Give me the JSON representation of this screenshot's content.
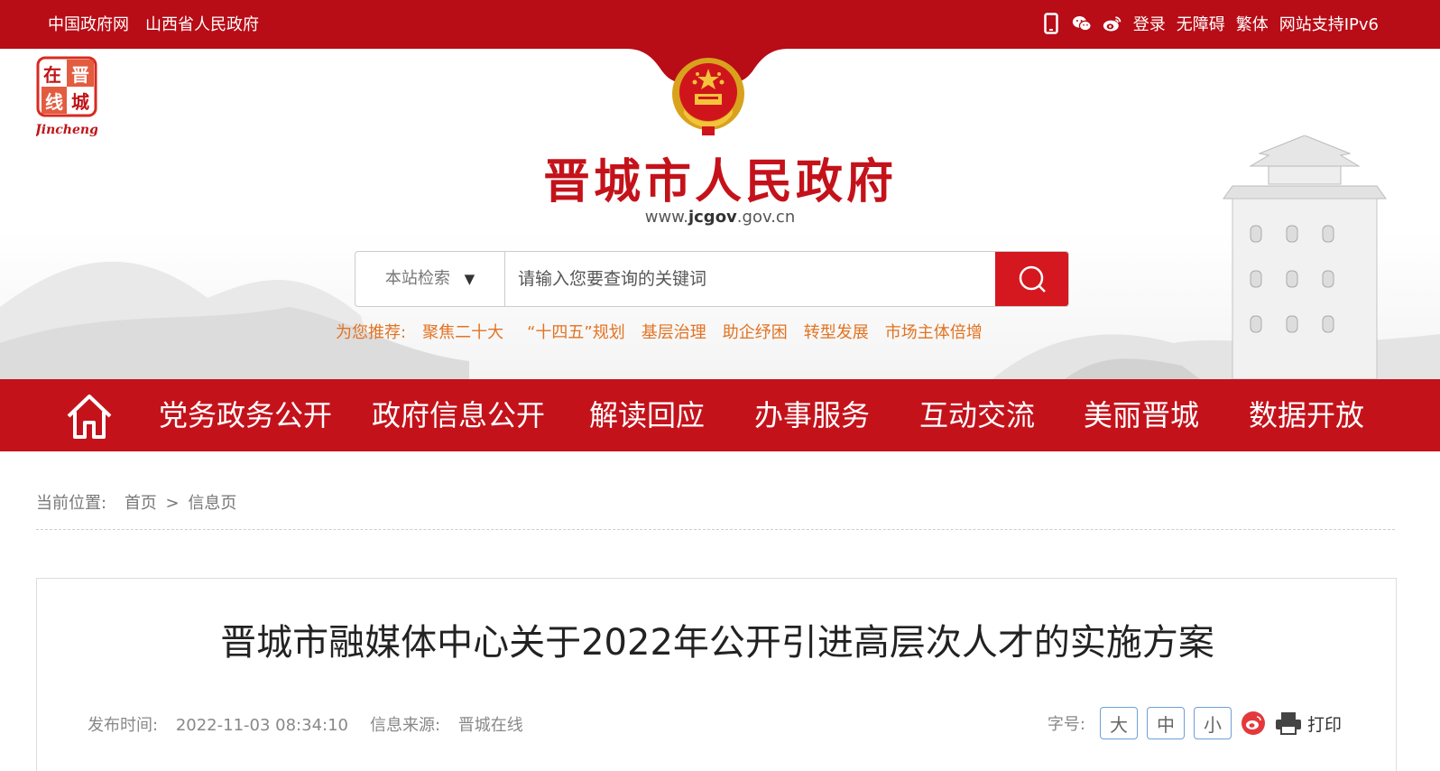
{
  "topbar": {
    "links_left": [
      "中国政府网",
      "山西省人民政府"
    ],
    "links_right": [
      "登录",
      "无障碍",
      "繁体",
      "网站支持IPv6"
    ],
    "icons": [
      "mobile-icon",
      "wechat-icon",
      "weibo-icon"
    ]
  },
  "header": {
    "logo_text": [
      "在",
      "晋",
      "线",
      "城"
    ],
    "logo_caption": "Jincheng",
    "title": "晋城市人民政府",
    "url_prefix": "www.",
    "url_main": "jcgov",
    "url_suffix": ".gov.cn"
  },
  "search": {
    "scope_label": "本站检索",
    "scope_arrow": "▼",
    "placeholder": "请输入您要查询的关键词"
  },
  "recommend": {
    "label": "为您推荐:",
    "items": [
      "聚焦二十大",
      "“十四五”规划",
      "基层治理",
      "助企纾困",
      "转型发展",
      "市场主体倍增"
    ]
  },
  "nav": {
    "items": [
      "党务政务公开",
      "政府信息公开",
      "解读回应",
      "办事服务",
      "互动交流",
      "美丽晋城",
      "数据开放"
    ]
  },
  "breadcrumb": {
    "label": "当前位置:",
    "home": "首页",
    "sep": ">",
    "current": "信息页"
  },
  "article": {
    "title": "晋城市融媒体中心关于2022年公开引进高层次人才的实施方案",
    "publish_label": "发布时间:",
    "publish_time": "2022-11-03 08:34:10",
    "source_label": "信息来源:",
    "source": "晋城在线",
    "font_label": "字号:",
    "font_sizes": [
      "大",
      "中",
      "小"
    ],
    "print_label": "打印"
  },
  "colors": {
    "brand_red": "#b80c16",
    "nav_red": "#c4121b",
    "recommend_orange": "#e27322"
  }
}
